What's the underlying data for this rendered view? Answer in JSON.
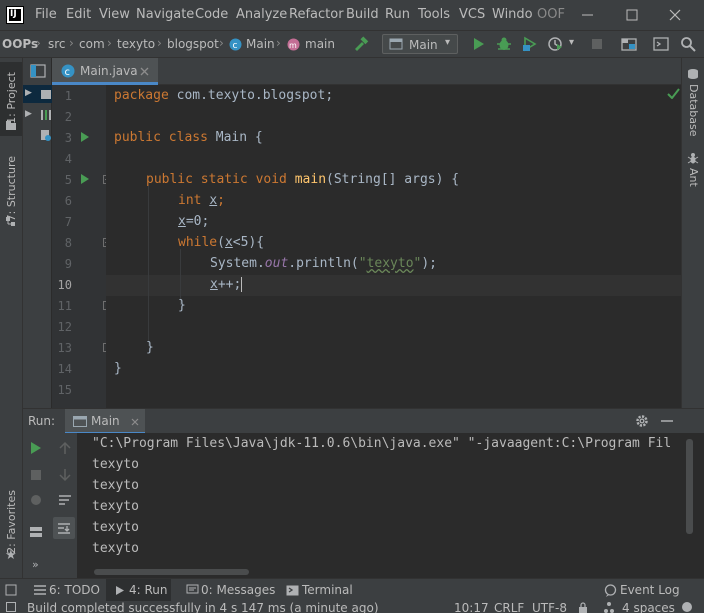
{
  "menubar": {
    "logo_label": "IJ",
    "items": [
      "File",
      "Edit",
      "View",
      "Navigate",
      "Code",
      "Analyze",
      "Refactor",
      "Build",
      "Run",
      "Tools",
      "VCS",
      "Windo",
      "OOF"
    ],
    "window_controls": [
      "minimize",
      "maximize",
      "close"
    ]
  },
  "navbar": {
    "breadcrumbs": [
      "OOPs",
      "src",
      "com",
      "texyto",
      "blogspot",
      "Main",
      "main"
    ],
    "run_config": "Main"
  },
  "left_stripe": {
    "project_label": "1: Project",
    "structure_label": "7: Structure",
    "favorites_label": "2: Favorites"
  },
  "right_stripe": {
    "database_label": "Database",
    "ant_label": "Ant"
  },
  "editor": {
    "tab_label": "Main.java",
    "line_numbers": [
      "1",
      "2",
      "3",
      "4",
      "5",
      "6",
      "7",
      "8",
      "9",
      "10",
      "11",
      "12",
      "13",
      "14",
      "15"
    ],
    "current_line": "10",
    "code": {
      "l1_kw": "package",
      "l1_rest": " com.texyto.blogspot;",
      "l3_kw": "public class",
      "l3_rest": " Main {",
      "l5_kw": "public static void",
      "l5_fn": "main",
      "l5_rest": "(String[] args) {",
      "l6_kw": "int",
      "l6_var": "x",
      "l6_semi": ";",
      "l7_var": "x",
      "l7_rest": "=0;",
      "l8_kw": "while",
      "l8_p1": "(",
      "l8_var": "x",
      "l8_rest": "<5){",
      "l9_a": "System.",
      "l9_field": "out",
      "l9_b": ".println(",
      "l9_q1": "\"",
      "l9_str": "texyto",
      "l9_q2": "\"",
      "l9_c": ");",
      "l10_var": "x",
      "l10_rest": "++;",
      "l11": "}",
      "l13": "}",
      "l14": "}"
    }
  },
  "run_panel": {
    "header_label": "Run:",
    "tab_label": "Main",
    "console_lines": [
      "\"C:\\Program Files\\Java\\jdk-11.0.6\\bin\\java.exe\" \"-javaagent:C:\\Program Fil",
      "texyto",
      "texyto",
      "texyto",
      "texyto",
      "texyto"
    ]
  },
  "bottom_tabs": {
    "todo": "6: TODO",
    "run": "4: Run",
    "messages": "0: Messages",
    "terminal": "Terminal",
    "event_log": "Event Log"
  },
  "status": {
    "message": "Build completed successfully in 4 s 147 ms (a minute ago)",
    "position": "10:17",
    "line_sep": "CRLF",
    "encoding": "UTF-8",
    "indent": "4 spaces"
  },
  "colors": {
    "keyword": "#cc7832",
    "string": "#6a8759",
    "field": "#9876aa",
    "function": "#ffc66d",
    "run_green": "#499c54",
    "accent_blue": "#4a88c7"
  }
}
